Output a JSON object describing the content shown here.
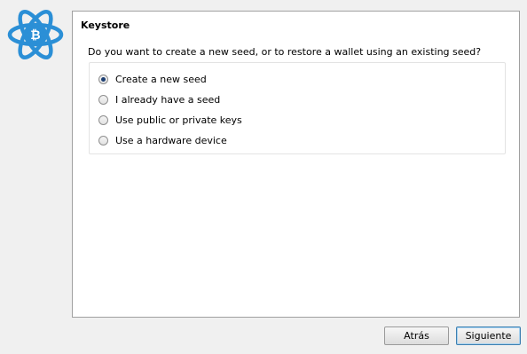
{
  "panel": {
    "title": "Keystore",
    "question": "Do you want to create a new seed, or to restore a wallet using an existing seed?"
  },
  "options": [
    {
      "label": "Create a new seed",
      "checked": true
    },
    {
      "label": "I already have a seed",
      "checked": false
    },
    {
      "label": "Use public or private keys",
      "checked": false
    },
    {
      "label": "Use a hardware device",
      "checked": false
    }
  ],
  "buttons": {
    "back_label": "Atrás",
    "next_label": "Siguiente"
  },
  "logo": {
    "icon": "electrum-bitcoin-atom-icon",
    "color": "#2b8fd6"
  }
}
